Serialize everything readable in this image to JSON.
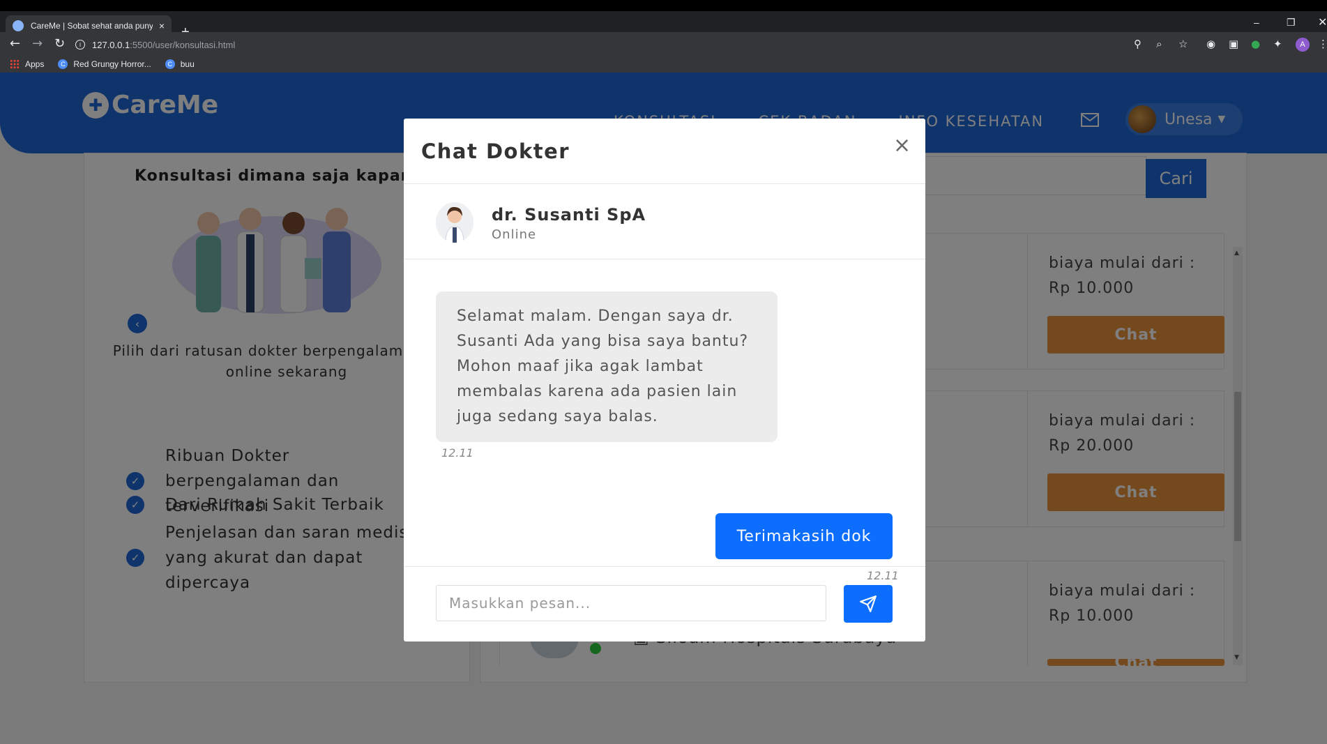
{
  "browser": {
    "tab_title": "CareMe | Sobat sehat anda puny",
    "tab_close": "×",
    "new_tab": "+",
    "url_host": "127.0.0.1",
    "url_path": ":5500/user/konsultasi.html",
    "bookmarks": [
      {
        "label": "Apps"
      },
      {
        "label": "Red Grungy Horror..."
      },
      {
        "label": "buu"
      }
    ],
    "profile_initial": "A"
  },
  "header": {
    "logo_text": "CareMe",
    "nav": [
      "KONSULTASI",
      "CEK BADAN",
      "INFO KESEHATAN"
    ],
    "user_name": "Unesa"
  },
  "left_panel": {
    "heading": "Konsultasi dimana saja kapan saja",
    "caption": "Pilih dari ratusan dokter berpengalaman chat online sekarang",
    "features": [
      "Ribuan Dokter berpengalaman dan terverifikasi",
      "Dari Rumah Sakit Terbaik",
      "Penjelasan dan saran medis yang akurat dan dapat dipercaya"
    ]
  },
  "search": {
    "button_label": "Cari"
  },
  "doctor_list": [
    {
      "price_label": "biaya mulai dari :",
      "price": "Rp 10.000",
      "chat_label": "Chat"
    },
    {
      "price_label": "biaya mulai dari :",
      "price": "Rp 20.000",
      "chat_label": "Chat"
    },
    {
      "price_label": "biaya mulai dari :",
      "price": "Rp 10.000",
      "chat_label": "Chat"
    }
  ],
  "hospital_text": "Siloam Hospitals Surabaya",
  "modal": {
    "title": "Chat Dokter",
    "close": "×",
    "doctor_name": "dr. Susanti SpA",
    "doctor_status": "Online",
    "messages": [
      {
        "from": "doctor",
        "text": "Selamat malam. Dengan saya dr. Susanti Ada yang bisa saya bantu? Mohon maaf jika agak lambat membalas karena ada pasien lain juga sedang saya balas.",
        "time": "12.11"
      },
      {
        "from": "user",
        "text": "Terimakasih dok",
        "time": "12.11"
      }
    ],
    "input_placeholder": "Masukkan pesan...",
    "accent_color": "#0d6efd"
  }
}
